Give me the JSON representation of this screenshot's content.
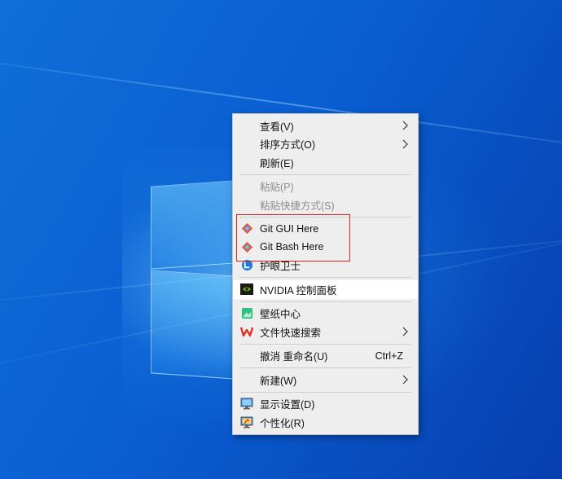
{
  "menu": {
    "view": {
      "label": "查看(V)"
    },
    "sort": {
      "label": "排序方式(O)"
    },
    "refresh": {
      "label": "刷新(E)"
    },
    "paste": {
      "label": "粘贴(P)"
    },
    "paste_shortcut": {
      "label": "粘贴快捷方式(S)"
    },
    "git_gui": {
      "label": "Git GUI Here"
    },
    "git_bash": {
      "label": "Git Bash Here"
    },
    "eye_guard": {
      "label": "护眼卫士"
    },
    "nvidia": {
      "label": "NVIDIA 控制面板"
    },
    "wallpaper": {
      "label": "壁纸中心"
    },
    "file_search": {
      "label": "文件快速搜索"
    },
    "undo": {
      "label": "撤消 重命名(U)",
      "shortcut": "Ctrl+Z"
    },
    "new": {
      "label": "新建(W)"
    },
    "display": {
      "label": "显示设置(D)"
    },
    "personalize": {
      "label": "个性化(R)"
    }
  },
  "colors": {
    "highlight_box": "#e02020",
    "git_logo": "#f05133",
    "nvidia_green": "#76b900",
    "wps_red": "#e0332a"
  }
}
